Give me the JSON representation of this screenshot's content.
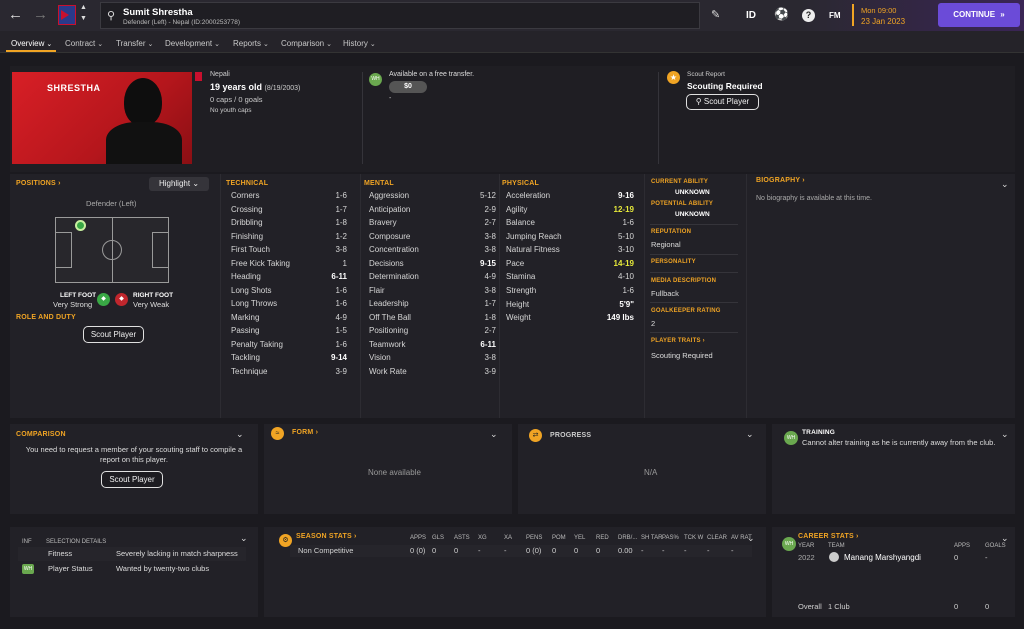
{
  "topbar": {
    "player_name": "Sumit Shrestha",
    "player_sub": "Defender (Left) - Nepal (ID:2000253778)",
    "id_label": "ID",
    "fm_label": "FM",
    "help_label": "?",
    "time": "Mon 09:00",
    "date": "23 Jan 2023",
    "continue_label": "CONTINUE"
  },
  "tabs": [
    "Overview",
    "Contract",
    "Transfer",
    "Development",
    "Reports",
    "Comparison",
    "History"
  ],
  "header": {
    "banner_name": "SHRESTHA",
    "nationality": "Nepali",
    "age": "19 years old",
    "dob": "(8/19/2003)",
    "caps": "0 caps / 0 goals",
    "youth_caps": "No youth caps",
    "transfer_text": "Available on a free transfer.",
    "transfer_value": "$0",
    "transfer_dash": "-",
    "scout_report_label": "Scout Report",
    "scouting_status": "Scouting Required",
    "scout_button": "Scout Player"
  },
  "positions": {
    "title": "POSITIONS",
    "highlight": "Highlight",
    "position_label": "Defender (Left)",
    "left_foot_label": "LEFT FOOT",
    "left_foot_value": "Very Strong",
    "right_foot_label": "RIGHT FOOT",
    "right_foot_value": "Very Weak",
    "role_title": "ROLE AND DUTY",
    "scout_button": "Scout Player"
  },
  "technical": {
    "title": "TECHNICAL",
    "items": [
      {
        "n": "Corners",
        "v": "1-6"
      },
      {
        "n": "Crossing",
        "v": "1-7"
      },
      {
        "n": "Dribbling",
        "v": "1-8"
      },
      {
        "n": "Finishing",
        "v": "1-2"
      },
      {
        "n": "First Touch",
        "v": "3-8"
      },
      {
        "n": "Free Kick Taking",
        "v": "1"
      },
      {
        "n": "Heading",
        "v": "6-11"
      },
      {
        "n": "Long Shots",
        "v": "1-6"
      },
      {
        "n": "Long Throws",
        "v": "1-6"
      },
      {
        "n": "Marking",
        "v": "4-9"
      },
      {
        "n": "Passing",
        "v": "1-5"
      },
      {
        "n": "Penalty Taking",
        "v": "1-6"
      },
      {
        "n": "Tackling",
        "v": "9-14"
      },
      {
        "n": "Technique",
        "v": "3-9"
      }
    ]
  },
  "mental": {
    "title": "MENTAL",
    "items": [
      {
        "n": "Aggression",
        "v": "5-12"
      },
      {
        "n": "Anticipation",
        "v": "2-9"
      },
      {
        "n": "Bravery",
        "v": "2-7"
      },
      {
        "n": "Composure",
        "v": "3-8"
      },
      {
        "n": "Concentration",
        "v": "3-8"
      },
      {
        "n": "Decisions",
        "v": "9-15"
      },
      {
        "n": "Determination",
        "v": "4-9"
      },
      {
        "n": "Flair",
        "v": "3-8"
      },
      {
        "n": "Leadership",
        "v": "1-7"
      },
      {
        "n": "Off The Ball",
        "v": "1-8"
      },
      {
        "n": "Positioning",
        "v": "2-7"
      },
      {
        "n": "Teamwork",
        "v": "6-11"
      },
      {
        "n": "Vision",
        "v": "3-8"
      },
      {
        "n": "Work Rate",
        "v": "3-9"
      }
    ]
  },
  "physical": {
    "title": "PHYSICAL",
    "items": [
      {
        "n": "Acceleration",
        "v": "9-16"
      },
      {
        "n": "Agility",
        "v": "12-19"
      },
      {
        "n": "Balance",
        "v": "1-6"
      },
      {
        "n": "Jumping Reach",
        "v": "5-10"
      },
      {
        "n": "Natural Fitness",
        "v": "3-10"
      },
      {
        "n": "Pace",
        "v": "14-19"
      },
      {
        "n": "Stamina",
        "v": "4-10"
      },
      {
        "n": "Strength",
        "v": "1-6"
      }
    ],
    "height_label": "Height",
    "height": "5'9\"",
    "weight_label": "Weight",
    "weight": "149 lbs"
  },
  "info": {
    "ca_label": "CURRENT ABILITY",
    "ca_value": "UNKNOWN",
    "pa_label": "POTENTIAL ABILITY",
    "pa_value": "UNKNOWN",
    "rep_label": "REPUTATION",
    "rep_value": "Regional",
    "personality_label": "PERSONALITY",
    "media_label": "MEDIA DESCRIPTION",
    "media_value": "Fullback",
    "gk_label": "GOALKEEPER RATING",
    "gk_value": "2",
    "traits_label": "PLAYER TRAITS",
    "traits_value": "Scouting Required"
  },
  "biography": {
    "title": "BIOGRAPHY",
    "text": "No biography is available at this time."
  },
  "comparison": {
    "title": "COMPARISON",
    "text": "You need to request a member of your scouting staff to compile a report on this player.",
    "button": "Scout Player"
  },
  "form": {
    "title": "FORM",
    "text": "None available"
  },
  "progress": {
    "title": "PROGRESS",
    "text": "N/A"
  },
  "training": {
    "title": "TRAINING",
    "text": "Cannot alter training as he is currently away from the club.",
    "badge": "WH"
  },
  "inf": {
    "col1": "INF",
    "col2": "SELECTION DETAILS",
    "rows": [
      {
        "badge": "",
        "label": "Fitness",
        "value": "Severely lacking in match sharpness"
      },
      {
        "badge": "WH",
        "label": "Player Status",
        "value": "Wanted by twenty-two clubs"
      }
    ]
  },
  "season": {
    "title": "SEASON STATS",
    "headers": [
      "APPS",
      "GLS",
      "ASTS",
      "XG",
      "XA",
      "PENS",
      "POM",
      "YEL",
      "RED",
      "DRB/...",
      "SH TAR",
      "PAS%",
      "TCK W",
      "CLEAR",
      "AV RAT"
    ],
    "row_label": "Non Competitive",
    "values": [
      "0 (0)",
      "0",
      "0",
      "-",
      "-",
      "0 (0)",
      "0",
      "0",
      "0",
      "0.00",
      "-",
      "-",
      "-",
      "-",
      "-"
    ]
  },
  "career": {
    "title": "CAREER STATS",
    "badge": "WH",
    "year_label": "YEAR",
    "team_label": "TEAM",
    "apps_label": "APPS",
    "goals_label": "GOALS",
    "year": "2022",
    "team": "Manang Marshyangdi",
    "apps": "0",
    "goals": "-",
    "overall_label": "Overall",
    "overall_clubs": "1 Club",
    "overall_apps": "0",
    "overall_goals": "0"
  },
  "colors": {
    "accent": "#f0a424",
    "continue": "#6b4bd8",
    "highlight_value": "#e5e83a",
    "green": "#39a845",
    "red": "#c0262d"
  }
}
